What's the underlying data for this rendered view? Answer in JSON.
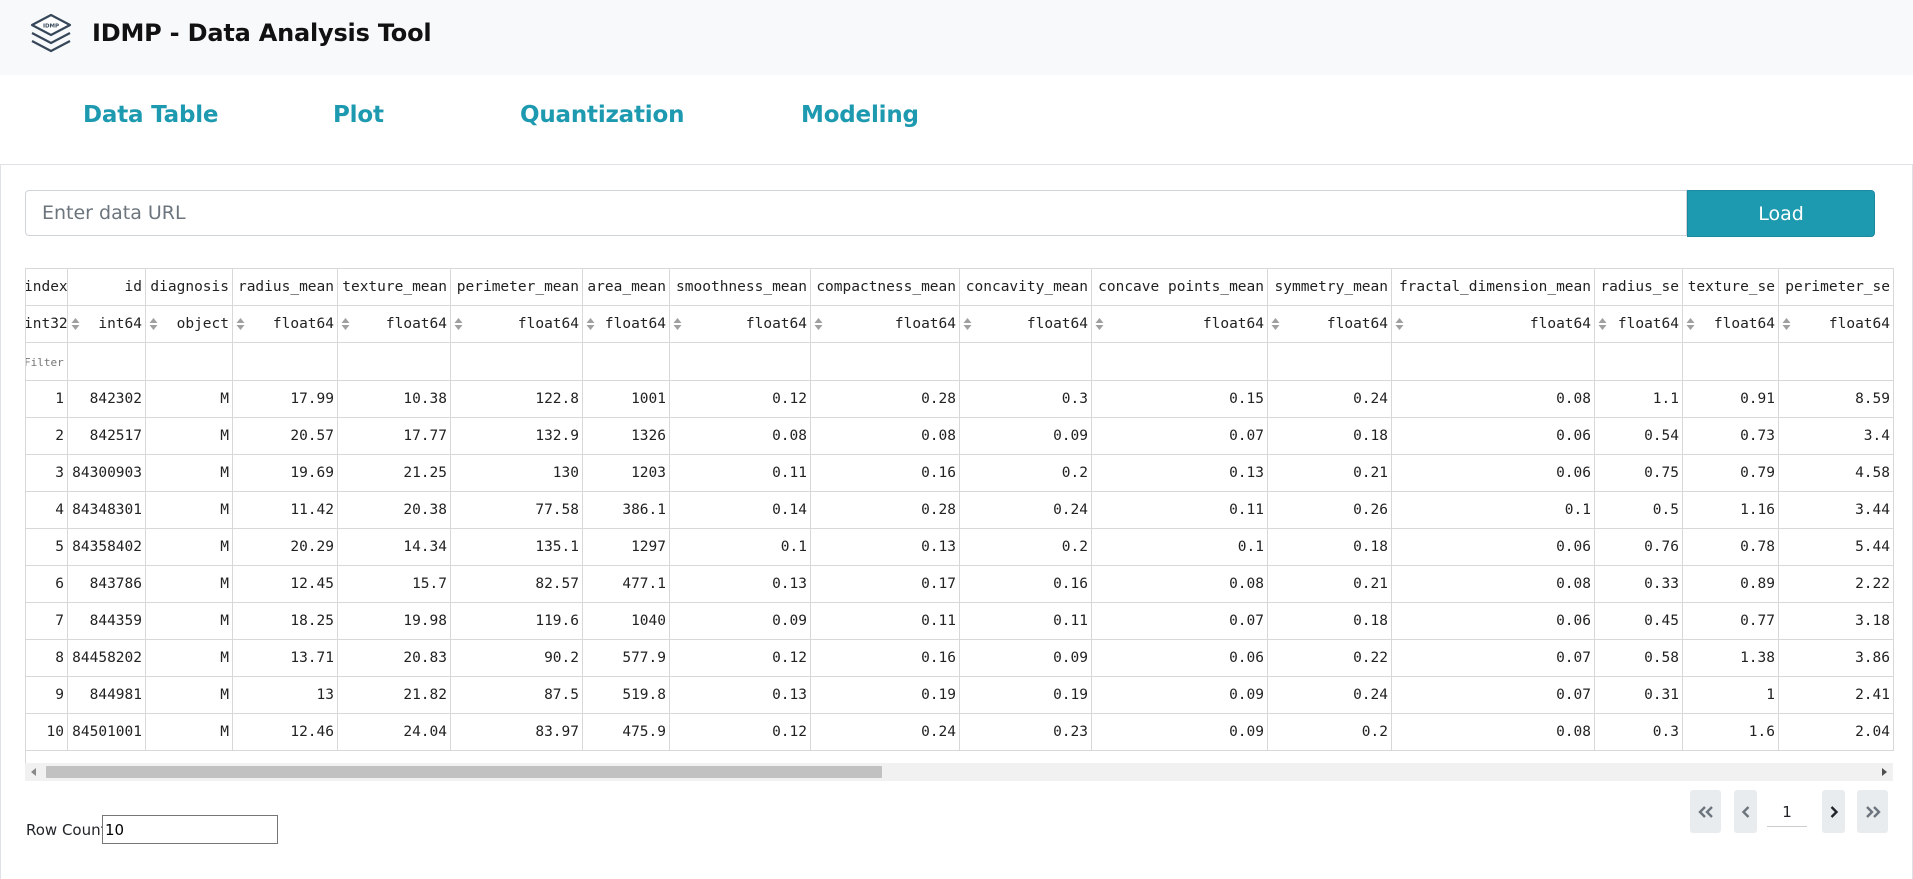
{
  "app": {
    "title": "IDMP - Data Analysis Tool",
    "logo_text": "IDMP",
    "logo_icon": "stacked-layers-logo"
  },
  "tabs": [
    {
      "label": "Data Table"
    },
    {
      "label": "Plot"
    },
    {
      "label": "Quantization"
    },
    {
      "label": "Modeling"
    }
  ],
  "loader": {
    "url_placeholder": "Enter data URL",
    "url_value": "",
    "load_label": "Load"
  },
  "table": {
    "columns": [
      "index",
      "id",
      "diagnosis",
      "radius_mean",
      "texture_mean",
      "perimeter_mean",
      "area_mean",
      "smoothness_mean",
      "compactness_mean",
      "concavity_mean",
      "concave points_mean",
      "symmetry_mean",
      "fractal_dimension_mean",
      "radius_se",
      "texture_se",
      "perimeter_se"
    ],
    "dtypes": [
      "int32",
      "int64",
      "object",
      "float64",
      "float64",
      "float64",
      "float64",
      "float64",
      "float64",
      "float64",
      "float64",
      "float64",
      "float64",
      "float64",
      "float64",
      "float64"
    ],
    "filter_placeholder": "Filter data...",
    "rows": [
      [
        "1",
        "842302",
        "M",
        "17.99",
        "10.38",
        "122.8",
        "1001",
        "0.12",
        "0.28",
        "0.3",
        "0.15",
        "0.24",
        "0.08",
        "1.1",
        "0.91",
        "8.59"
      ],
      [
        "2",
        "842517",
        "M",
        "20.57",
        "17.77",
        "132.9",
        "1326",
        "0.08",
        "0.08",
        "0.09",
        "0.07",
        "0.18",
        "0.06",
        "0.54",
        "0.73",
        "3.4"
      ],
      [
        "3",
        "84300903",
        "M",
        "19.69",
        "21.25",
        "130",
        "1203",
        "0.11",
        "0.16",
        "0.2",
        "0.13",
        "0.21",
        "0.06",
        "0.75",
        "0.79",
        "4.58"
      ],
      [
        "4",
        "84348301",
        "M",
        "11.42",
        "20.38",
        "77.58",
        "386.1",
        "0.14",
        "0.28",
        "0.24",
        "0.11",
        "0.26",
        "0.1",
        "0.5",
        "1.16",
        "3.44"
      ],
      [
        "5",
        "84358402",
        "M",
        "20.29",
        "14.34",
        "135.1",
        "1297",
        "0.1",
        "0.13",
        "0.2",
        "0.1",
        "0.18",
        "0.06",
        "0.76",
        "0.78",
        "5.44"
      ],
      [
        "6",
        "843786",
        "M",
        "12.45",
        "15.7",
        "82.57",
        "477.1",
        "0.13",
        "0.17",
        "0.16",
        "0.08",
        "0.21",
        "0.08",
        "0.33",
        "0.89",
        "2.22"
      ],
      [
        "7",
        "844359",
        "M",
        "18.25",
        "19.98",
        "119.6",
        "1040",
        "0.09",
        "0.11",
        "0.11",
        "0.07",
        "0.18",
        "0.06",
        "0.45",
        "0.77",
        "3.18"
      ],
      [
        "8",
        "84458202",
        "M",
        "13.71",
        "20.83",
        "90.2",
        "577.9",
        "0.12",
        "0.16",
        "0.09",
        "0.06",
        "0.22",
        "0.07",
        "0.58",
        "1.38",
        "3.86"
      ],
      [
        "9",
        "844981",
        "M",
        "13",
        "21.82",
        "87.5",
        "519.8",
        "0.13",
        "0.19",
        "0.19",
        "0.09",
        "0.24",
        "0.07",
        "0.31",
        "1",
        "2.41"
      ],
      [
        "10",
        "84501001",
        "M",
        "12.46",
        "24.04",
        "83.97",
        "475.9",
        "0.12",
        "0.24",
        "0.23",
        "0.09",
        "0.2",
        "0.08",
        "0.3",
        "1.6",
        "2.04"
      ]
    ],
    "horizontal_scroll_position": 0
  },
  "footer": {
    "row_count_label": "Row Count:",
    "row_count_value": "10",
    "page_value": "1",
    "pager_icons": [
      "first-page-icon",
      "prev-page-icon",
      "next-page-icon",
      "last-page-icon"
    ]
  },
  "colors": {
    "accent": "#1e9ab0",
    "header_bg": "#f8f9fa",
    "pager_bg": "#e9ecef"
  }
}
